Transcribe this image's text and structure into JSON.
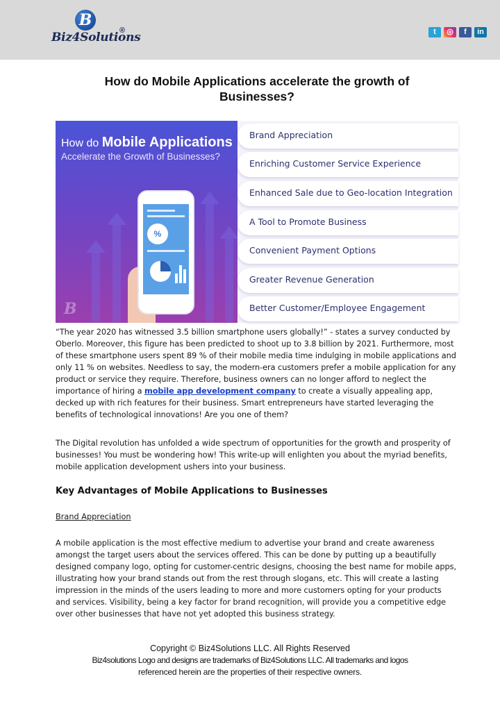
{
  "header": {
    "logo_text": "Biz4Solutions",
    "logo_mark": "B",
    "logo_reg": "®",
    "social": [
      {
        "name": "twitter",
        "glyph": "t"
      },
      {
        "name": "instagram",
        "glyph": "◎"
      },
      {
        "name": "facebook",
        "glyph": "f"
      },
      {
        "name": "linkedin",
        "glyph": "in"
      }
    ]
  },
  "title": "How do Mobile Applications accelerate the growth of Businesses?",
  "banner": {
    "heading_prefix": "How do",
    "heading_bold": "Mobile Applications",
    "subheading": "Accelerate the Growth of Businesses?",
    "phone_pie_label": "%",
    "items": [
      "Brand Appreciation",
      "Enriching Customer Service Experience",
      "Enhanced Sale due to Geo-location Integration",
      "A Tool to Promote Business",
      "Convenient Payment Options",
      "Greater Revenue Generation",
      "Better Customer/Employee Engagement"
    ]
  },
  "paragraphs": {
    "p1_before_link": "“The year 2020 has witnessed 3.5 billion smartphone users globally!” - states a survey conducted by Oberlo. Moreover, this figure has been predicted to shoot up to 3.8 billion by 2021. Furthermore, most of these smartphone users spent 89 % of their mobile media time indulging in mobile applications and only 11 % on websites. Needless to say, the modern-era customers prefer a mobile application for any product or service they require. Therefore, business owners can no longer afford to neglect the importance of hiring a ",
    "p1_link": "mobile app development company",
    "p1_after_link": " to create a visually appealing app, decked up with rich features for their business. Smart entrepreneurs have started leveraging the benefits of technological innovations! Are you one of them?",
    "p2": "The Digital revolution has unfolded a wide spectrum of opportunities for the growth and prosperity of businesses! You must be wondering how! This write-up will enlighten you about the myriad benefits, mobile application development ushers into your business.",
    "section_heading": "Key Advantages of Mobile Applications to Businesses",
    "sub_heading": "Brand Appreciation",
    "p3": "A mobile application is the most effective medium to advertise your brand and create awareness amongst the target users about the services offered. This can be done by putting up a beautifully designed company logo, opting for customer-centric designs, choosing the best name for mobile apps, illustrating how your brand stands out from the rest through slogans, etc. This will create a lasting impression in the minds of the users leading to more and more customers opting for your products and services. Visibility, being a key factor for brand recognition, will provide you a competitive edge over other businesses that have not yet adopted this business strategy."
  },
  "footer": {
    "line1": "Copyright © Biz4Solutions LLC. All Rights Reserved",
    "line2": "Biz4solutions Logo and designs are trademarks of Biz4Solutions LLC. All trademarks and logos",
    "line3": "referenced herein are the properties of their respective owners."
  }
}
